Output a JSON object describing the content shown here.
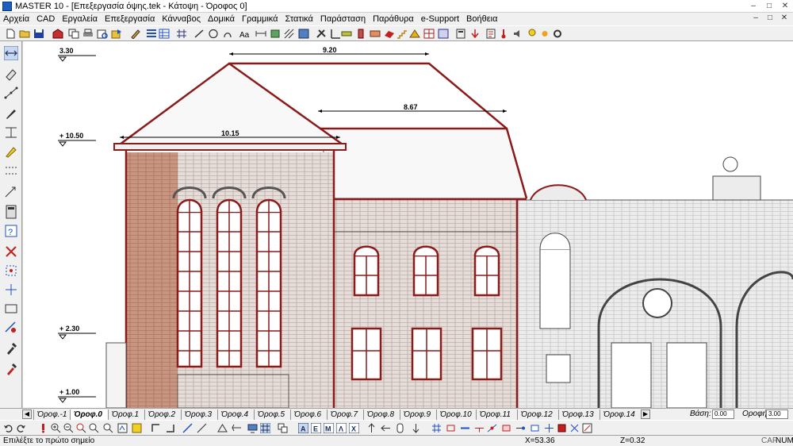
{
  "window": {
    "title": "MASTER 10 - [Επεξεργασία όψης.tek - Κάτοψη - Όροφος 0]",
    "min": "–",
    "max": "□",
    "close": "✕"
  },
  "menu": [
    {
      "label": "Αρχεία"
    },
    {
      "label": "CAD"
    },
    {
      "label": "Εργαλεία"
    },
    {
      "label": "Επεξεργασία"
    },
    {
      "label": "Κάνναβος"
    },
    {
      "label": "Δομικά"
    },
    {
      "label": "Γραμμικά"
    },
    {
      "label": "Στατικά"
    },
    {
      "label": "Παράσταση"
    },
    {
      "label": "Παράθυρα"
    },
    {
      "label": "e-Support"
    },
    {
      "label": "Βοήθεια"
    }
  ],
  "drawing": {
    "levels": [
      "3.30",
      "+ 10.50",
      "+ 2.30",
      "+ 1.00"
    ],
    "dimensions": [
      "9.20",
      "8.67",
      "10.15"
    ],
    "line_color": "#8b1a1a"
  },
  "tabs": {
    "items": [
      "Όροφ.-1",
      "Όροφ.0",
      "Όροφ.1",
      "Όροφ.2",
      "Όροφ.3",
      "Όροφ.4",
      "Όροφ.5",
      "Όροφ.6",
      "Όροφ.7",
      "Όροφ.8",
      "Όροφ.9",
      "Όροφ.10",
      "Όροφ.11",
      "Όροφ.12",
      "Όροφ.13",
      "Όροφ.14"
    ],
    "active_index": 1,
    "base_label": "Βάση:",
    "base_value": "0.00",
    "height_label": "Οροφή:",
    "height_value": "3.00"
  },
  "status": {
    "message": "Επιλέξτε το πρώτο σημείο",
    "x": "X=53.36",
    "z": "Z=0.32",
    "caf": "CAF",
    "num": "NUM"
  }
}
